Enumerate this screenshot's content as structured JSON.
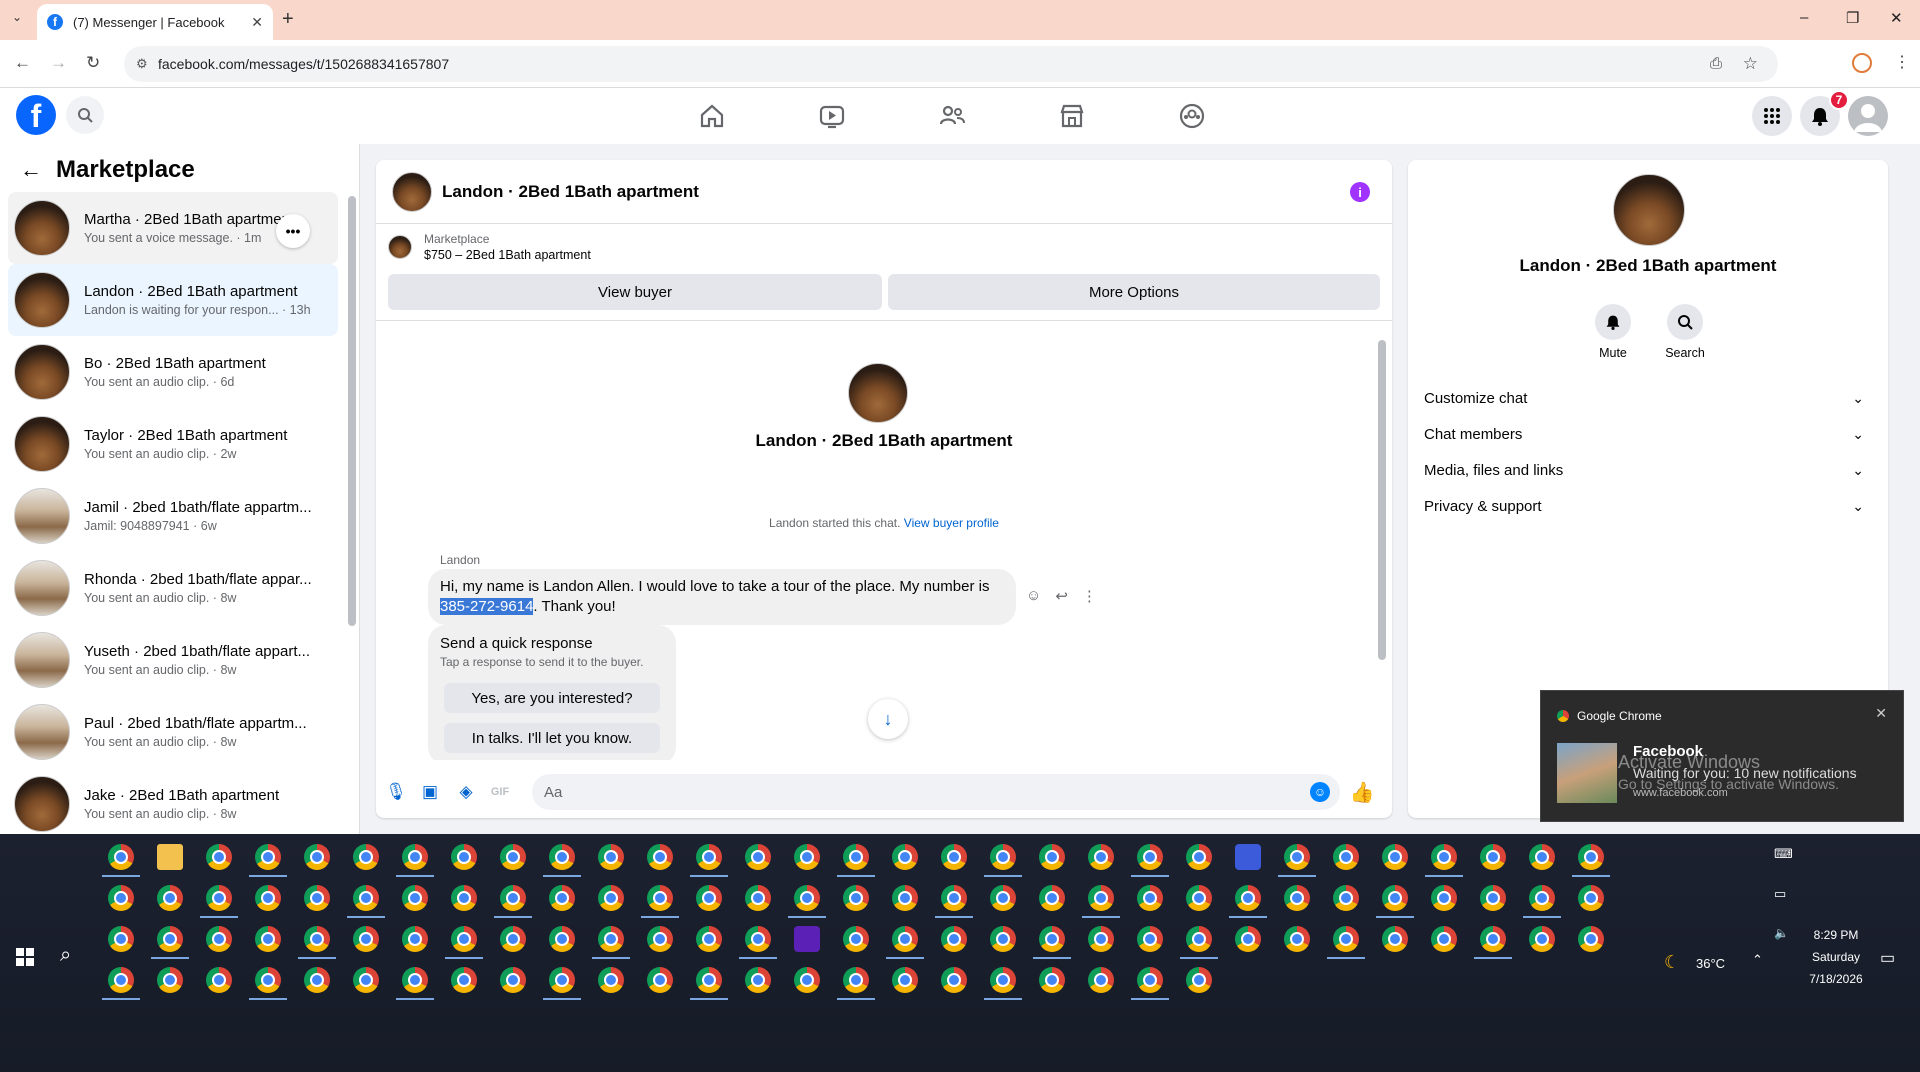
{
  "browser": {
    "tab_title": "(7) Messenger | Facebook",
    "url": "facebook.com/messages/t/1502688341657807",
    "window_controls": [
      "–",
      "❐",
      "✕"
    ]
  },
  "fb_header": {
    "notification_count": "7",
    "nav_icons": [
      "home-icon",
      "video-icon",
      "friends-icon",
      "marketplace-icon",
      "groups-icon"
    ]
  },
  "sidebar": {
    "title": "Marketplace",
    "conversations": [
      {
        "name": "Martha · 2Bed 1Bath apartment",
        "sub": "You sent a voice message. · 1m"
      },
      {
        "name": "Landon · 2Bed 1Bath apartment",
        "sub": "Landon is waiting for your respon... · 13h"
      },
      {
        "name": "Bo · 2Bed 1Bath apartment",
        "sub": "You sent an audio clip. · 6d"
      },
      {
        "name": "Taylor · 2Bed 1Bath apartment",
        "sub": "You sent an audio clip. · 2w"
      },
      {
        "name": "Jamil · 2bed 1bath/flate appartm...",
        "sub": "Jamil: 9048897941 · 6w"
      },
      {
        "name": "Rhonda · 2bed 1bath/flate appar...",
        "sub": "You sent an audio clip. · 8w"
      },
      {
        "name": "Yuseth · 2bed 1bath/flate appart...",
        "sub": "You sent an audio clip. · 8w"
      },
      {
        "name": "Paul · 2bed 1bath/flate appartm...",
        "sub": "You sent an audio clip. · 8w"
      },
      {
        "name": "Jake · 2Bed 1Bath apartment",
        "sub": "You sent an audio clip. · 8w"
      }
    ],
    "more_label": "•••"
  },
  "chat": {
    "title": "Landon · 2Bed 1Bath apartment",
    "info_icon": "i",
    "listing_label": "Marketplace",
    "listing_detail": "$750 – 2Bed 1Bath apartment",
    "view_buyer": "View buyer",
    "more_options": "More Options",
    "intro_name": "Landon · 2Bed 1Bath apartment",
    "started_text": "Landon started this chat.",
    "view_profile_link": "View buyer profile",
    "sender": "Landon",
    "message_part1": "Hi, my name is Landon Allen. I would love to take a tour of the place. My number is",
    "message_phone": "385-272-9614",
    "message_part2": ". Thank you!",
    "quick_title": "Send a quick response",
    "quick_sub": "Tap a response to send it to the buyer.",
    "quick_options": [
      "Yes, are you interested?",
      "In talks. I'll let you know."
    ],
    "input_placeholder": "Aa"
  },
  "details": {
    "name": "Landon · 2Bed 1Bath apartment",
    "mute": "Mute",
    "search": "Search",
    "sections": [
      "Customize chat",
      "Chat members",
      "Media, files and links",
      "Privacy & support"
    ]
  },
  "toast": {
    "app": "Google Chrome",
    "title": "Facebook",
    "message": "Waiting for you: 10 new notifications",
    "source": "www.facebook.com",
    "watermark1": "Activate Windows",
    "watermark2": "Go to Settings to activate Windows."
  },
  "taskbar": {
    "temperature": "36°C",
    "time": "8:29 PM",
    "day": "Saturday",
    "date": "7/18/2026"
  }
}
